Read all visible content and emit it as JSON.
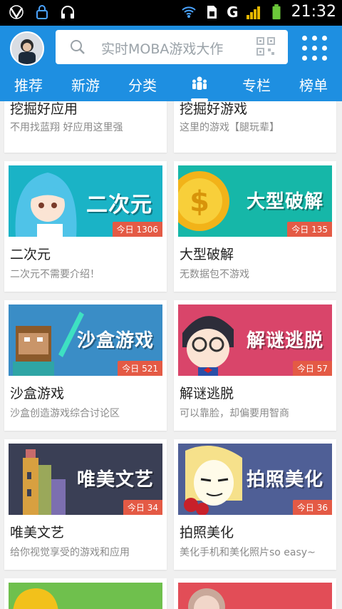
{
  "status_bar": {
    "time": "21:32",
    "network": "G"
  },
  "header": {
    "search_placeholder": "实时MOBA游戏大作",
    "tabs": [
      {
        "label": "推荐"
      },
      {
        "label": "新游"
      },
      {
        "label": "分类"
      },
      {
        "label": "",
        "icon": "people-icon",
        "active": true
      },
      {
        "label": "专栏"
      },
      {
        "label": "榜单"
      }
    ]
  },
  "cards": [
    {
      "title": "挖掘好应用",
      "desc": "不用找蓝翔 好应用这里强"
    },
    {
      "title": "挖掘好游戏",
      "desc": "这里的游戏【腿玩辈】"
    },
    {
      "title": "二次元",
      "desc": "二次元不需要介绍！",
      "badge": "今日 1306",
      "banner_text": "二次元",
      "banner_color": "#1ab3c6"
    },
    {
      "title": "大型破解",
      "desc": "无数据包不游戏",
      "badge": "今日 135",
      "banner_text": "大型破解",
      "banner_color": "#16b7a8"
    },
    {
      "title": "沙盒游戏",
      "desc": "沙盒创造游戏综合讨论区",
      "badge": "今日 521",
      "banner_text": "沙盒游戏",
      "banner_color": "#3a8dc6"
    },
    {
      "title": "解谜逃脱",
      "desc": "可以靠脸，却偏要用智商",
      "badge": "今日 57",
      "banner_text": "解谜逃脱",
      "banner_color": "#d9456a"
    },
    {
      "title": "唯美文艺",
      "desc": "给你视觉享受的游戏和应用",
      "badge": "今日 34",
      "banner_text": "唯美文艺",
      "banner_color": "#3a3f55"
    },
    {
      "title": "拍照美化",
      "desc": "美化手机和美化照片so easy~",
      "badge": "今日 36",
      "banner_text": "拍照美化",
      "banner_color": "#4f5f96"
    },
    {
      "title": "",
      "desc": "",
      "banner_color": "#6fc04d"
    },
    {
      "title": "",
      "desc": "",
      "banner_color": "#e24d57"
    }
  ]
}
